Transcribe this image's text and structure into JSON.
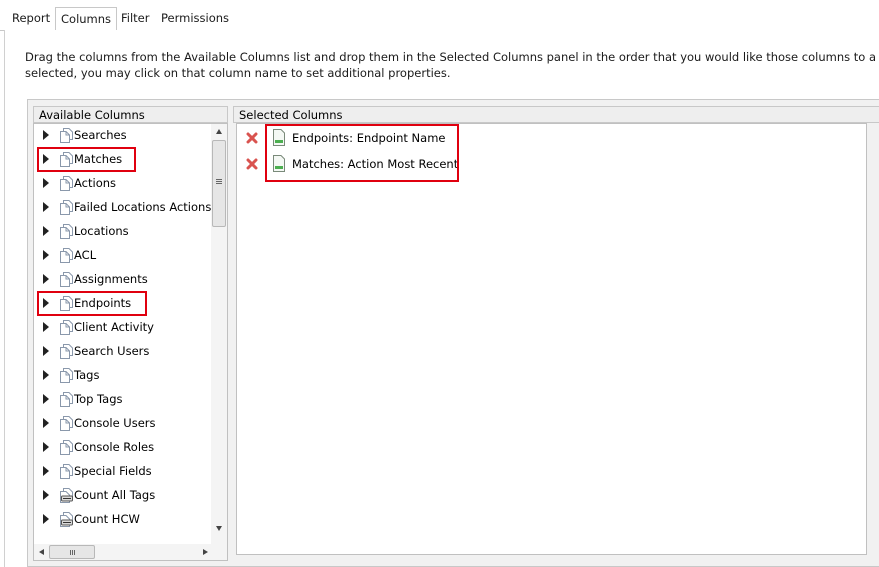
{
  "tabs": [
    {
      "label": "Report",
      "active": false
    },
    {
      "label": "Columns",
      "active": true
    },
    {
      "label": "Filter",
      "active": false
    },
    {
      "label": "Permissions",
      "active": false
    }
  ],
  "instructions": {
    "line1": "Drag the columns from the Available Columns list and drop them in the Selected Columns panel in the order that you would like those columns to appear",
    "line2": "selected, you may click on that column name to set additional properties."
  },
  "available": {
    "header": "Available Columns",
    "items": [
      {
        "label": "Searches",
        "icon": "pages-icon"
      },
      {
        "label": "Matches",
        "icon": "pages-icon"
      },
      {
        "label": "Actions",
        "icon": "pages-icon"
      },
      {
        "label": "Failed Locations Actions",
        "icon": "pages-icon"
      },
      {
        "label": "Locations",
        "icon": "pages-icon"
      },
      {
        "label": "ACL",
        "icon": "pages-icon"
      },
      {
        "label": "Assignments",
        "icon": "pages-icon"
      },
      {
        "label": "Endpoints",
        "icon": "pages-icon"
      },
      {
        "label": "Client Activity",
        "icon": "pages-icon"
      },
      {
        "label": "Search Users",
        "icon": "pages-icon"
      },
      {
        "label": "Tags",
        "icon": "pages-icon"
      },
      {
        "label": "Top Tags",
        "icon": "pages-icon"
      },
      {
        "label": "Console Users",
        "icon": "pages-icon"
      },
      {
        "label": "Console Roles",
        "icon": "pages-icon"
      },
      {
        "label": "Special Fields",
        "icon": "pages-icon"
      },
      {
        "label": "Count All Tags",
        "icon": "count-icon"
      },
      {
        "label": "Count HCW",
        "icon": "count-icon"
      }
    ]
  },
  "selected": {
    "header": "Selected Columns",
    "items": [
      {
        "label": "Endpoints: Endpoint Name"
      },
      {
        "label": "Matches: Action Most Recent"
      }
    ]
  },
  "colors": {
    "highlight": "#e0000f",
    "remove": "#d9534f",
    "doc_accent": "#4caf50"
  }
}
